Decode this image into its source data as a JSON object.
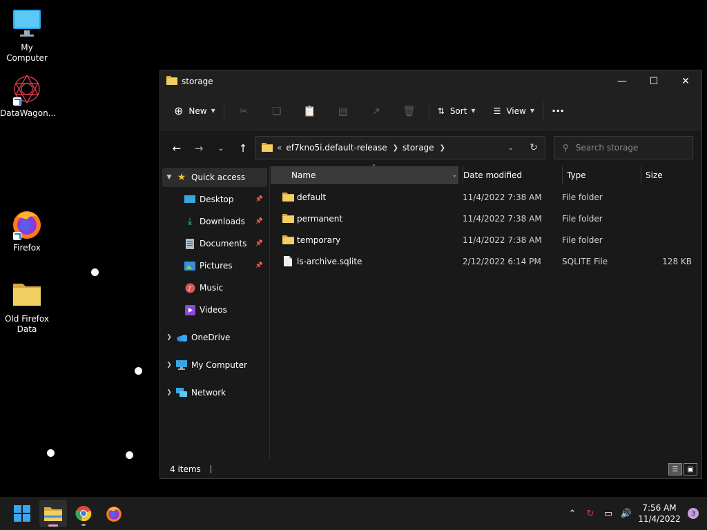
{
  "desktop": {
    "icons": [
      {
        "label": "My Computer"
      },
      {
        "label": "DataWagon..."
      },
      {
        "label": "Firefox"
      },
      {
        "label": "Old Firefox Data"
      }
    ]
  },
  "window": {
    "title": "storage",
    "toolbar": {
      "new_label": "New",
      "sort_label": "Sort",
      "view_label": "View",
      "more_label": "···"
    },
    "address": {
      "overflow": "«",
      "crumbs": [
        "ef7kno5i.default-release",
        "storage"
      ]
    },
    "search_placeholder": "Search storage",
    "sidebar": {
      "items": [
        {
          "label": "Quick access"
        },
        {
          "label": "Desktop"
        },
        {
          "label": "Downloads"
        },
        {
          "label": "Documents"
        },
        {
          "label": "Pictures"
        },
        {
          "label": "Music"
        },
        {
          "label": "Videos"
        },
        {
          "label": "OneDrive"
        },
        {
          "label": "My Computer"
        },
        {
          "label": "Network"
        }
      ]
    },
    "columns": {
      "name": "Name",
      "date": "Date modified",
      "type": "Type",
      "size": "Size"
    },
    "files": [
      {
        "name": "default",
        "date": "11/4/2022 7:38 AM",
        "type": "File folder",
        "size": ""
      },
      {
        "name": "permanent",
        "date": "11/4/2022 7:38 AM",
        "type": "File folder",
        "size": ""
      },
      {
        "name": "temporary",
        "date": "11/4/2022 7:38 AM",
        "type": "File folder",
        "size": ""
      },
      {
        "name": "ls-archive.sqlite",
        "date": "2/12/2022 6:14 PM",
        "type": "SQLITE File",
        "size": "128 KB"
      }
    ],
    "status": {
      "count": "4 items"
    }
  },
  "taskbar": {
    "clock": {
      "time": "7:56 AM",
      "date": "11/4/2022"
    },
    "notification_count": "3"
  },
  "colors": {
    "folder": "#e8c15a",
    "accent": "#4aa3f0"
  }
}
